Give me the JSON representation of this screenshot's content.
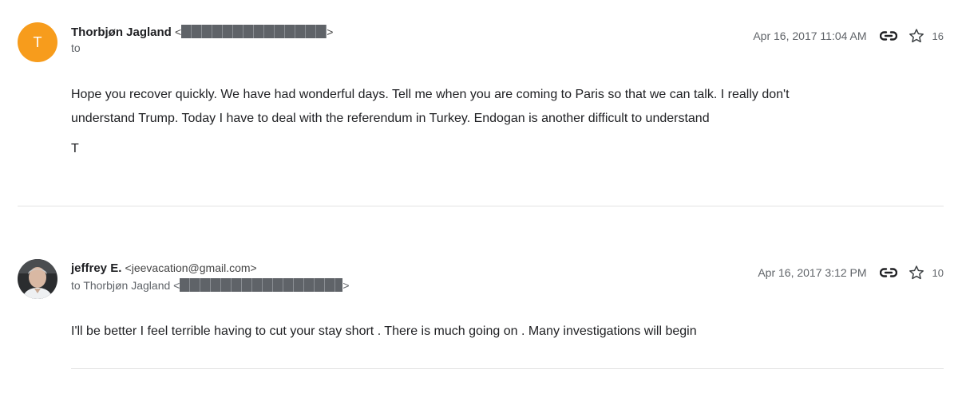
{
  "messages": [
    {
      "avatar_letter": "T",
      "sender_name": "Thorbjøn Jagland",
      "addr_open": "<",
      "addr_close": ">",
      "recipient_prefix": "to",
      "date": "Apr 16, 2017 11:04 AM",
      "count": "16",
      "body": [
        "Hope you recover quickly. We have had wonderful days. Tell me when you are coming to Paris so that we can talk. I really don't",
        "understand Trump. Today I have to deal with the referendum in Turkey. Endogan is another difficult to understand"
      ],
      "signature": "T"
    },
    {
      "sender_name": "jeffrey E.",
      "sender_email": "<jeevacation@gmail.com>",
      "recipient_prefix": "to Thorbjøn Jagland <",
      "recipient_close": ">",
      "date": "Apr 16, 2017 3:12 PM",
      "count": "10",
      "body": [
        "I'll be better I feel terrible having to cut your stay short . There is much going on . Many investigations will begin"
      ]
    }
  ],
  "icons": {
    "link": "link-icon",
    "star": "star-icon"
  },
  "colors": {
    "avatar_orange": "#f79c1c",
    "redaction": "#5f6368",
    "divider": "#e2e2e2"
  }
}
